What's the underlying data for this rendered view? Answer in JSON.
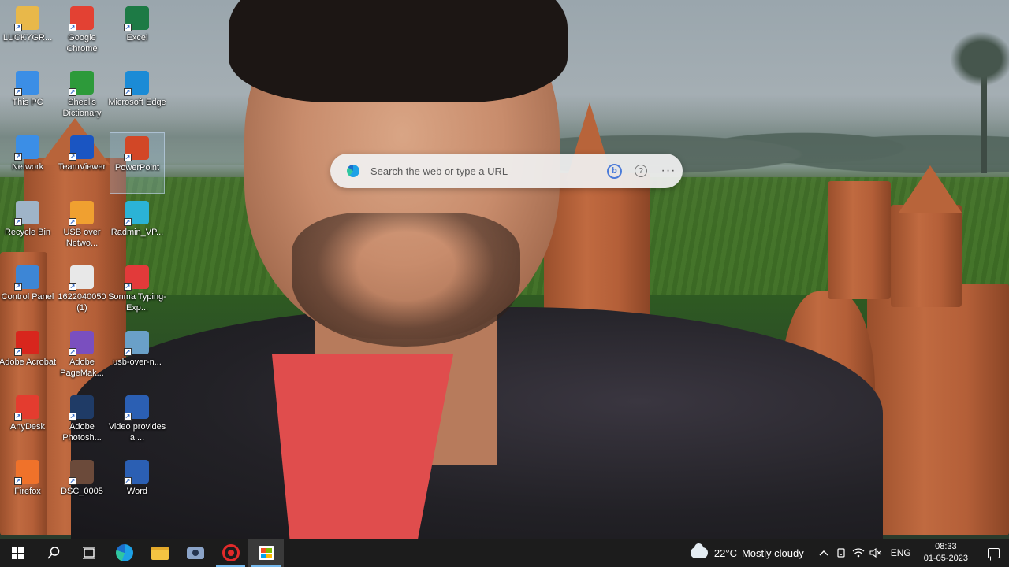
{
  "desktop": {
    "icons": [
      {
        "label": "LUCKYGR...",
        "icon": "user-folder-icon",
        "color": "#e8b84a"
      },
      {
        "label": "Google Chrome",
        "icon": "chrome-icon",
        "color": "#e34133"
      },
      {
        "label": "Excel",
        "icon": "excel-icon",
        "color": "#1d7a45"
      },
      {
        "label": "This PC",
        "icon": "this-pc-icon",
        "color": "#3b8ee6"
      },
      {
        "label": "Sheel's Dictionary",
        "icon": "dictionary-icon",
        "color": "#2d9a3a"
      },
      {
        "label": "Microsoft Edge",
        "icon": "edge-icon",
        "color": "#1b8bd6"
      },
      {
        "label": "Network",
        "icon": "network-icon",
        "color": "#3b8ee6"
      },
      {
        "label": "TeamViewer",
        "icon": "teamviewer-icon",
        "color": "#1a55c2"
      },
      {
        "label": "PowerPoint",
        "icon": "powerpoint-icon",
        "color": "#d24726"
      },
      {
        "label": "Recycle Bin",
        "icon": "recycle-bin-icon",
        "color": "#9fb4c8"
      },
      {
        "label": "USB over Netwo...",
        "icon": "usb-network-icon",
        "color": "#f0a030"
      },
      {
        "label": "Radmin_VP...",
        "icon": "radmin-vpn-icon",
        "color": "#2bb3d6"
      },
      {
        "label": "Control Panel",
        "icon": "control-panel-icon",
        "color": "#3d86d6"
      },
      {
        "label": "1622040050 (1)",
        "icon": "document-file-icon",
        "color": "#e8e8e8"
      },
      {
        "label": "Sonma Typing-Exp...",
        "icon": "sonma-typing-icon",
        "color": "#e23a3a"
      },
      {
        "label": "Adobe Acrobat",
        "icon": "adobe-acrobat-icon",
        "color": "#d8261d"
      },
      {
        "label": "Adobe PageMak...",
        "icon": "adobe-pagemaker-icon",
        "color": "#7a4fbf"
      },
      {
        "label": "usb-over-n...",
        "icon": "usb-installer-icon",
        "color": "#6aa0c8"
      },
      {
        "label": "AnyDesk",
        "icon": "anydesk-icon",
        "color": "#e43c2f"
      },
      {
        "label": "Adobe Photosh...",
        "icon": "adobe-photoshop-icon",
        "color": "#1f3b66"
      },
      {
        "label": "Video provides a ...",
        "icon": "word-document-icon",
        "color": "#2b5fb3"
      },
      {
        "label": "Firefox",
        "icon": "firefox-icon",
        "color": "#f0722a"
      },
      {
        "label": "DSC_0005",
        "icon": "image-file-icon",
        "color": "#6b4a3a"
      },
      {
        "label": "Word",
        "icon": "word-icon",
        "color": "#2b5fb3"
      }
    ],
    "selected_icon": "PowerPoint"
  },
  "search": {
    "placeholder": "Search the web or type a URL",
    "bing_label": "b",
    "help_label": "?",
    "more_label": "···"
  },
  "taskbar": {
    "apps": [
      {
        "name": "start",
        "icon": "windows-start-icon"
      },
      {
        "name": "search",
        "icon": "search-icon"
      },
      {
        "name": "task-view",
        "icon": "task-view-icon"
      },
      {
        "name": "edge",
        "icon": "edge-icon"
      },
      {
        "name": "file-explorer",
        "icon": "folder-icon"
      },
      {
        "name": "camera",
        "icon": "camera-icon"
      },
      {
        "name": "screen-recorder",
        "icon": "record-icon"
      },
      {
        "name": "store",
        "icon": "store-icon"
      }
    ],
    "weather": {
      "temp": "22°C",
      "condition": "Mostly cloudy"
    },
    "language": "ENG",
    "time": "08:33",
    "date": "01-05-2023"
  }
}
